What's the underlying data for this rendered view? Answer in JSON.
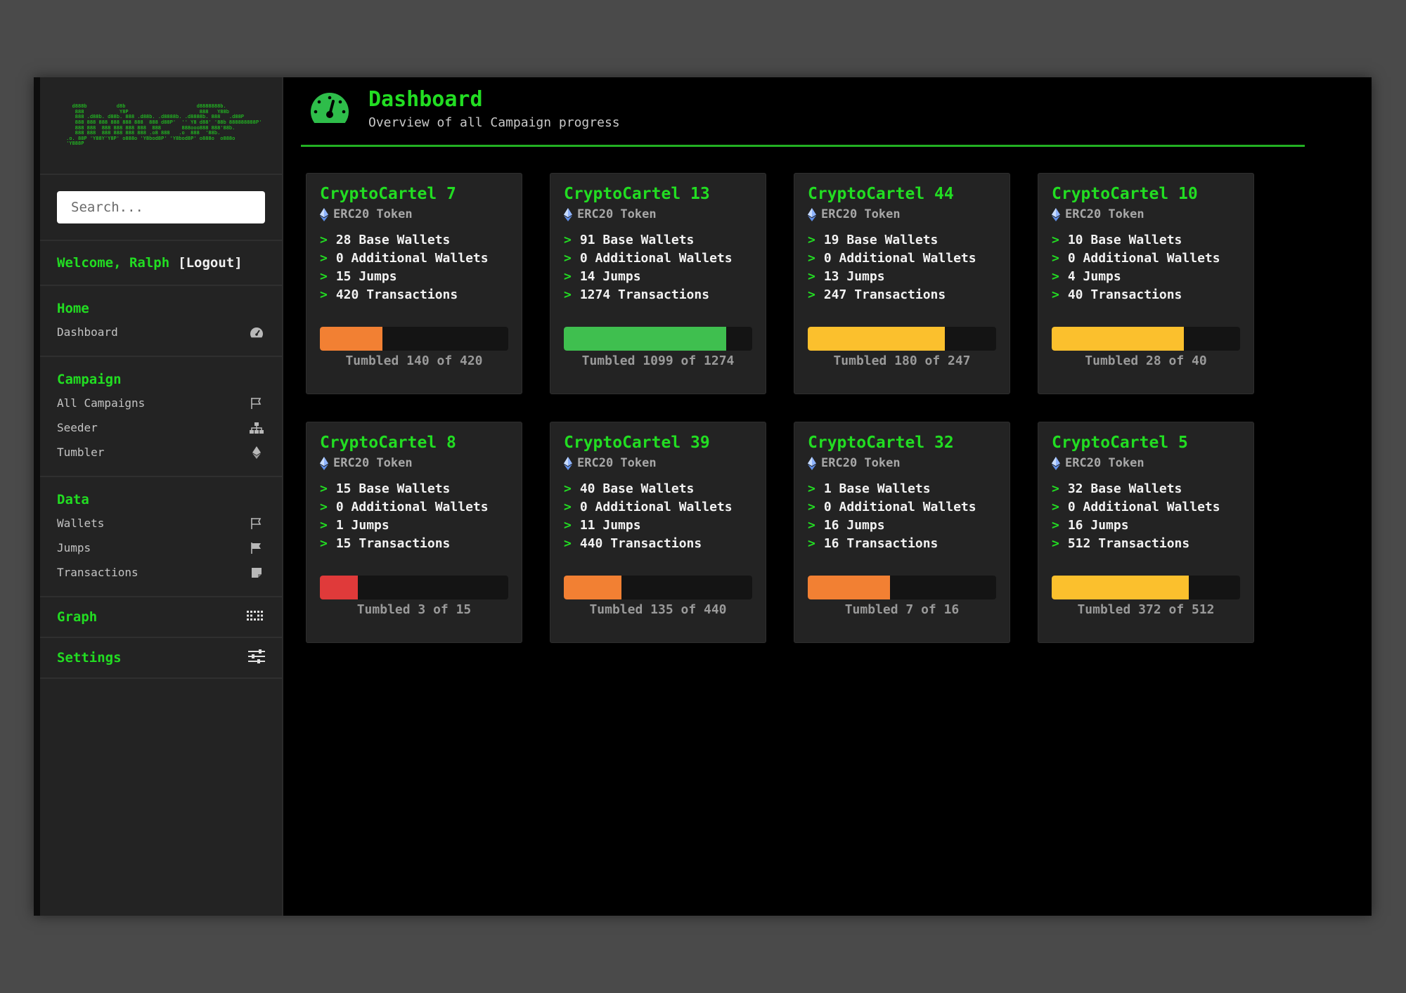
{
  "logo_art": "    d888b          d8b                        d8888888b.\n     888            Y8P                        888   Y88b\n     888 .d88b. d88b. 888 .d88b. .d8888b. .d8888b. 888   .d88P\n     888 888 888 888 888 888  888 d88P'  '' Y8 d88' '88b 888888888P'\n     888 888  888 888 888 888  888       888ooo888 888'88b.\n     888 888  888 888 888 888 .o8 888   .o  888  '88b.\n  .o. 88P 'Y88Y'Y8P' o888o 'Y8bod8P' 'Y8bod8P' o888o  o888o\n  'Y888P",
  "search": {
    "placeholder": "Search..."
  },
  "user": {
    "welcome": "Welcome, Ralph",
    "logout": "[Logout]"
  },
  "nav": {
    "home": {
      "title": "Home",
      "items": [
        {
          "label": "Dashboard",
          "icon": "gauge-icon"
        }
      ]
    },
    "campaign": {
      "title": "Campaign",
      "items": [
        {
          "label": "All Campaigns",
          "icon": "flag-outline-icon"
        },
        {
          "label": "Seeder",
          "icon": "sitemap-icon"
        },
        {
          "label": "Tumbler",
          "icon": "ethereum-icon"
        }
      ]
    },
    "data": {
      "title": "Data",
      "items": [
        {
          "label": "Wallets",
          "icon": "flag-outline-icon"
        },
        {
          "label": "Jumps",
          "icon": "flag-filled-icon"
        },
        {
          "label": "Transactions",
          "icon": "note-icon"
        }
      ]
    },
    "graph": {
      "title": "Graph",
      "icon": "grid-dots-icon"
    },
    "settings": {
      "title": "Settings",
      "icon": "sliders-icon"
    }
  },
  "header": {
    "title": "Dashboard",
    "subtitle": "Overview of all Campaign progress",
    "icon": "gauge-icon"
  },
  "colors": {
    "green": "#22dd22",
    "orange": "#f28033",
    "bar_green": "#3fbf4f",
    "yellow": "#fbc02d",
    "red": "#e03a3a"
  },
  "campaigns": [
    {
      "name": "CryptoCartel 7",
      "token": "ERC20 Token",
      "stats": [
        "28 Base Wallets",
        "0 Additional Wallets",
        "15 Jumps",
        "420 Transactions"
      ],
      "tumbled": "Tumbled 140 of 420",
      "progress": 0.333,
      "color": "#f28033"
    },
    {
      "name": "CryptoCartel 13",
      "token": "ERC20 Token",
      "stats": [
        "91 Base Wallets",
        "0 Additional Wallets",
        "14 Jumps",
        "1274 Transactions"
      ],
      "tumbled": "Tumbled 1099 of 1274",
      "progress": 0.863,
      "color": "#3fbf4f"
    },
    {
      "name": "CryptoCartel 44",
      "token": "ERC20 Token",
      "stats": [
        "19 Base Wallets",
        "0 Additional Wallets",
        "13 Jumps",
        "247 Transactions"
      ],
      "tumbled": "Tumbled 180 of 247",
      "progress": 0.729,
      "color": "#fbc02d"
    },
    {
      "name": "CryptoCartel 10",
      "token": "ERC20 Token",
      "stats": [
        "10 Base Wallets",
        "0 Additional Wallets",
        "4 Jumps",
        "40 Transactions"
      ],
      "tumbled": "Tumbled 28 of 40",
      "progress": 0.7,
      "color": "#fbc02d"
    },
    {
      "name": "CryptoCartel 8",
      "token": "ERC20 Token",
      "stats": [
        "15 Base Wallets",
        "0 Additional Wallets",
        "1 Jumps",
        "15 Transactions"
      ],
      "tumbled": "Tumbled 3 of 15",
      "progress": 0.2,
      "color": "#e03a3a"
    },
    {
      "name": "CryptoCartel 39",
      "token": "ERC20 Token",
      "stats": [
        "40 Base Wallets",
        "0 Additional Wallets",
        "11 Jumps",
        "440 Transactions"
      ],
      "tumbled": "Tumbled 135 of 440",
      "progress": 0.307,
      "color": "#f28033"
    },
    {
      "name": "CryptoCartel 32",
      "token": "ERC20 Token",
      "stats": [
        "1 Base Wallets",
        "0 Additional Wallets",
        "16 Jumps",
        "16 Transactions"
      ],
      "tumbled": "Tumbled 7 of 16",
      "progress": 0.4375,
      "color": "#f28033"
    },
    {
      "name": "CryptoCartel 5",
      "token": "ERC20 Token",
      "stats": [
        "32 Base Wallets",
        "0 Additional Wallets",
        "16 Jumps",
        "512 Transactions"
      ],
      "tumbled": "Tumbled 372 of 512",
      "progress": 0.727,
      "color": "#fbc02d"
    }
  ]
}
